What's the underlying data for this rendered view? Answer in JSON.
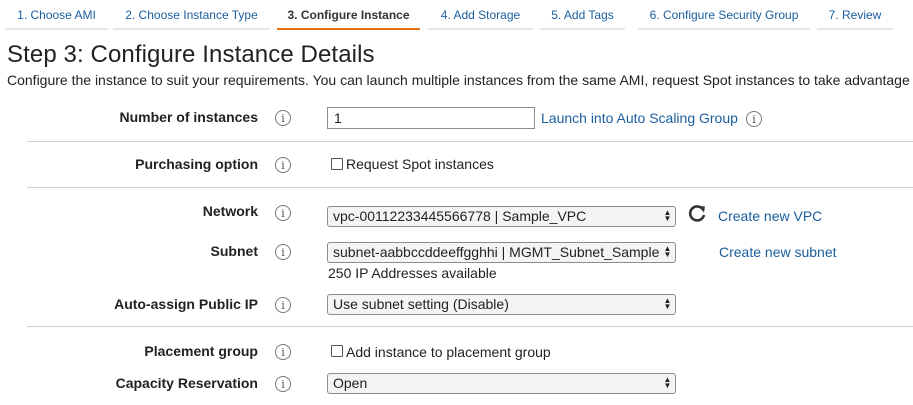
{
  "tabs": [
    {
      "label": "1. Choose AMI"
    },
    {
      "label": "2. Choose Instance Type"
    },
    {
      "label": "3. Configure Instance",
      "active": true
    },
    {
      "label": "4. Add Storage"
    },
    {
      "label": "5. Add Tags"
    },
    {
      "label": "6. Configure Security Group"
    },
    {
      "label": "7. Review"
    }
  ],
  "page": {
    "title": "Step 3: Configure Instance Details",
    "description": "Configure the instance to suit your requirements. You can launch multiple instances from the same AMI, request Spot instances to take advantage"
  },
  "info_glyph": "i",
  "form": {
    "instances": {
      "label": "Number of instances",
      "value": "1",
      "link": "Launch into Auto Scaling Group"
    },
    "purchasing": {
      "label": "Purchasing option",
      "checkbox_label": "Request Spot instances",
      "checked": false
    },
    "network": {
      "label": "Network",
      "value": "vpc-00112233445566778 | Sample_VPC",
      "link": "Create new VPC",
      "refresh_icon": "refresh-icon"
    },
    "subnet": {
      "label": "Subnet",
      "value": "subnet-aabbccddeeffgghhi | MGMT_Subnet_Sample",
      "link": "Create new subnet",
      "note": "250 IP Addresses available"
    },
    "public_ip": {
      "label": "Auto-assign Public IP",
      "value": "Use subnet setting (Disable)"
    },
    "placement": {
      "label": "Placement group",
      "checkbox_label": "Add instance to placement group",
      "checked": false
    },
    "capacity": {
      "label": "Capacity Reservation",
      "value": "Open"
    }
  },
  "colors": {
    "link": "#1a5e9e",
    "active_tab_underline": "#ec7211"
  }
}
